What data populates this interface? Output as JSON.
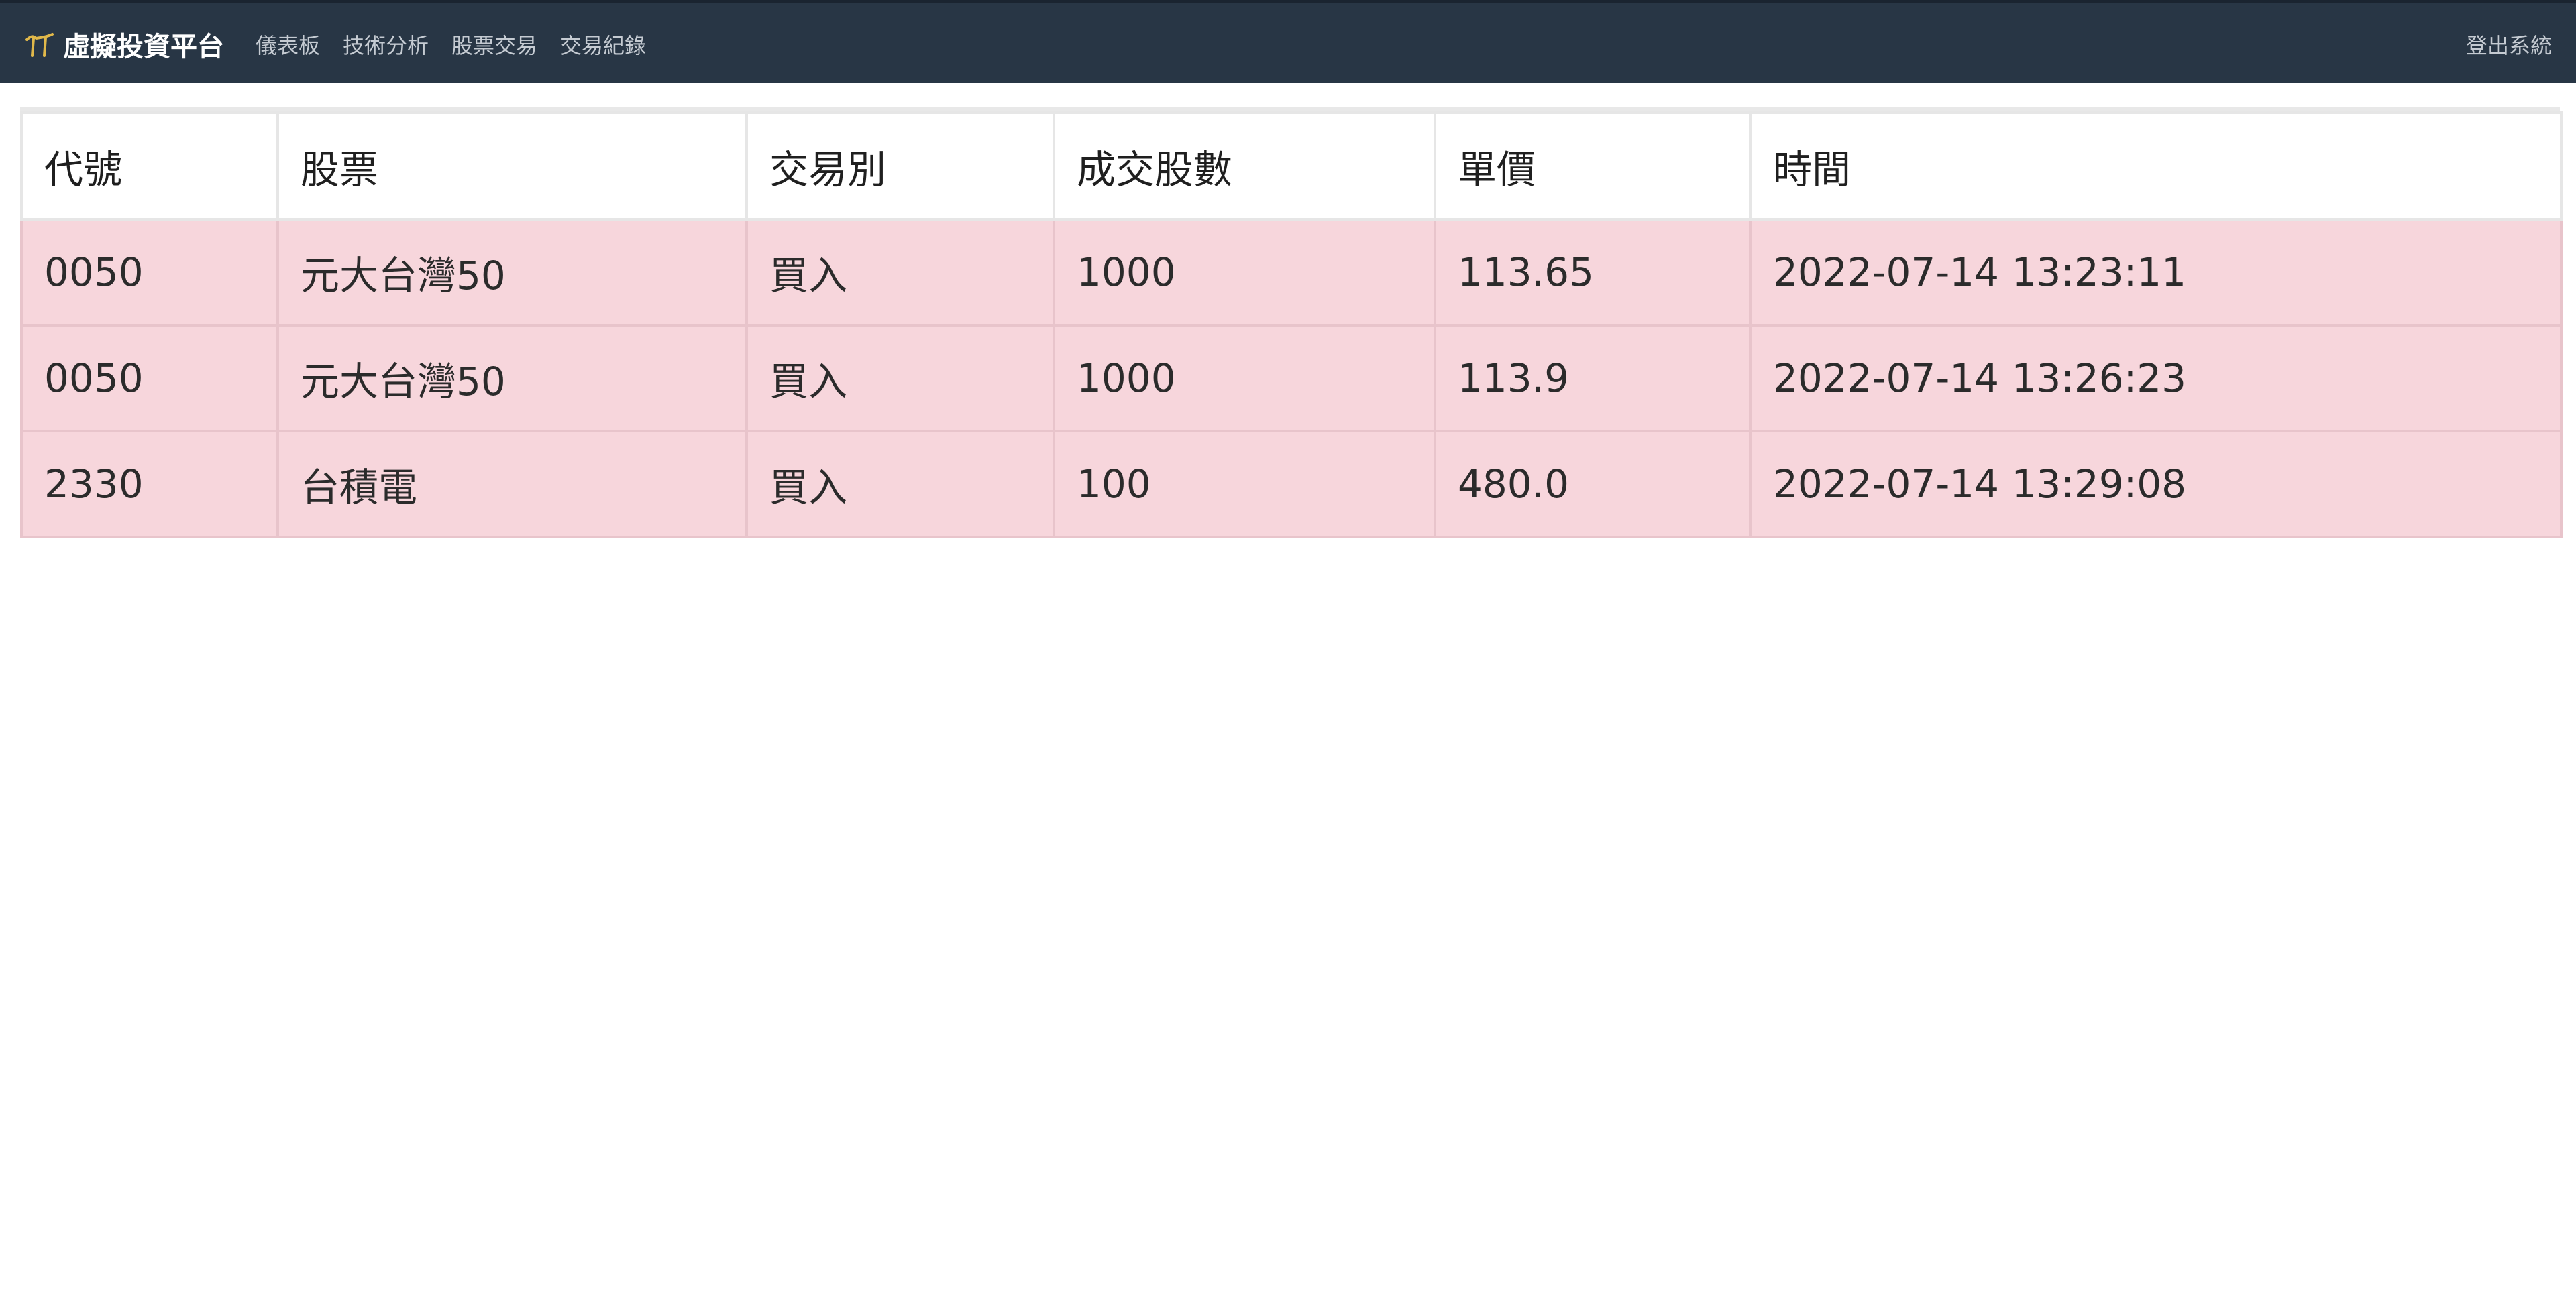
{
  "navbar": {
    "brand_title": "虛擬投資平台",
    "brand_icon": "chart-icon",
    "brand_icon_color": "#e0b84a",
    "background": "#283645",
    "links": [
      {
        "label": "儀表板"
      },
      {
        "label": "技術分析"
      },
      {
        "label": "股票交易"
      },
      {
        "label": "交易紀錄"
      }
    ],
    "logout_label": "登出系統"
  },
  "table": {
    "row_color": "#f7d6dc",
    "headers": [
      "代號",
      "股票",
      "交易別",
      "成交股數",
      "單價",
      "時間"
    ],
    "rows": [
      [
        "0050",
        "元大台灣50",
        "買入",
        "1000",
        "113.65",
        "2022-07-14 13:23:11"
      ],
      [
        "0050",
        "元大台灣50",
        "買入",
        "1000",
        "113.9",
        "2022-07-14 13:26:23"
      ],
      [
        "2330",
        "台積電",
        "買入",
        "100",
        "480.0",
        "2022-07-14 13:29:08"
      ]
    ]
  }
}
